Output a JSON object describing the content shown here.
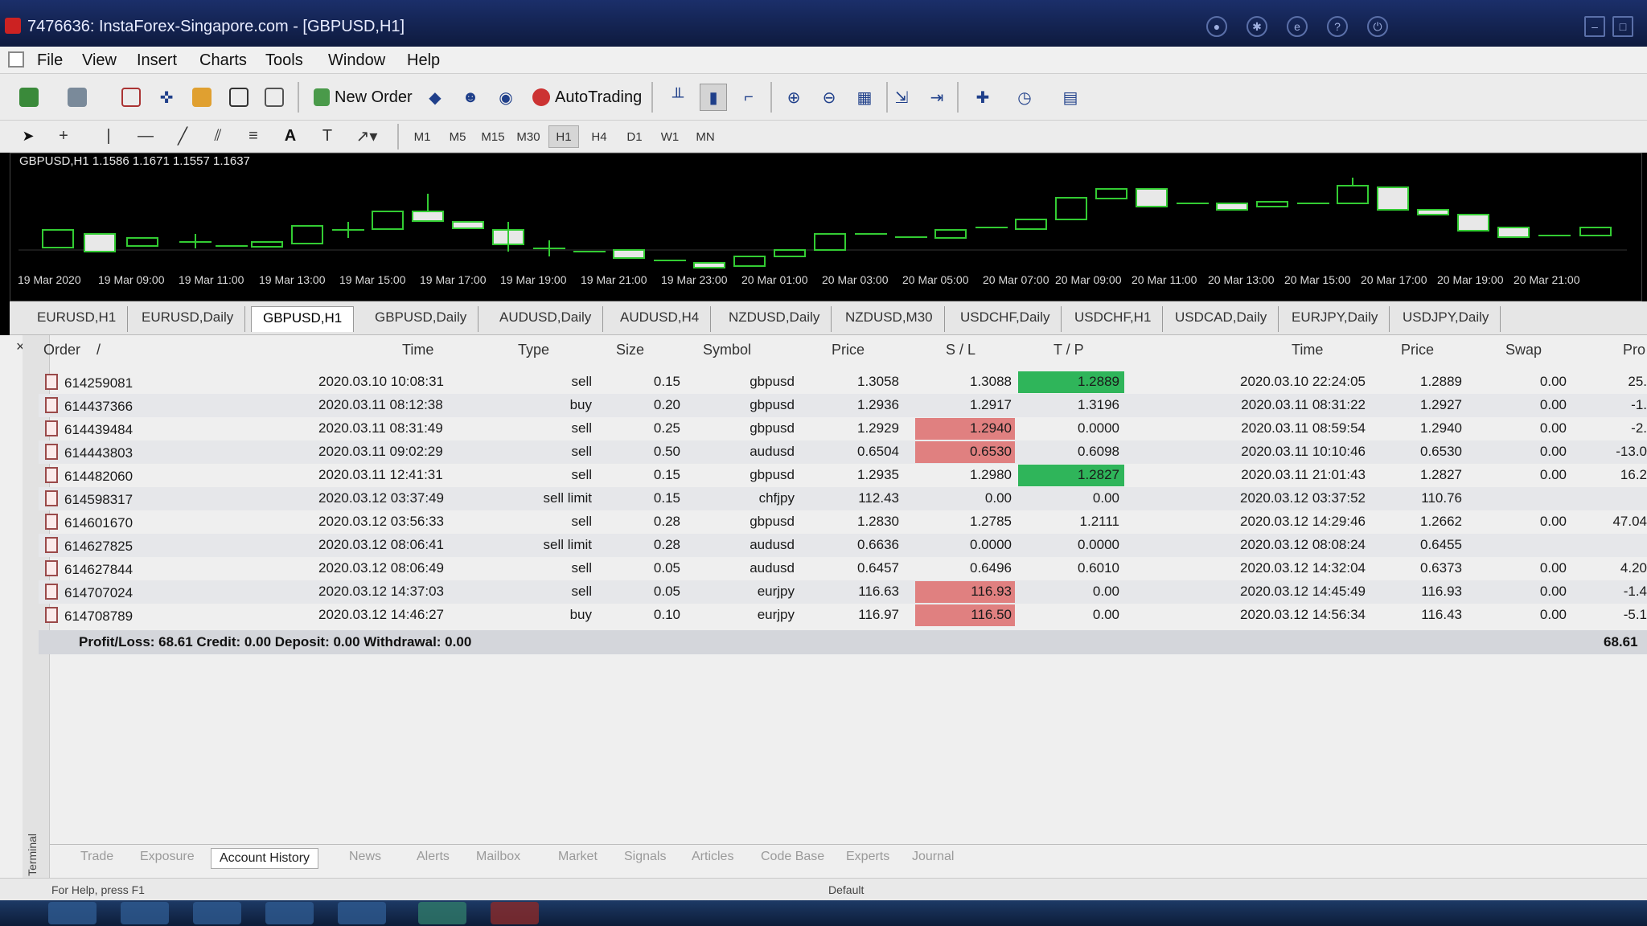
{
  "window": {
    "title": "7476636: InstaForex-Singapore.com - [GBPUSD,H1]"
  },
  "menu": [
    "File",
    "View",
    "Insert",
    "Charts",
    "Tools",
    "Window",
    "Help"
  ],
  "toolbar": {
    "new_order": "New Order",
    "auto_trading": "AutoTrading"
  },
  "timeframes": [
    "M1",
    "M5",
    "M15",
    "M30",
    "H1",
    "H4",
    "D1",
    "W1",
    "MN"
  ],
  "active_timeframe": "H1",
  "chart": {
    "label": "GBPUSD,H1  1.1586 1.1671 1.1557 1.1637",
    "time_labels": [
      "19 Mar 2020",
      "19 Mar 09:00",
      "19 Mar 11:00",
      "19 Mar 13:00",
      "19 Mar 15:00",
      "19 Mar 17:00",
      "19 Mar 19:00",
      "19 Mar 21:00",
      "19 Mar 23:00",
      "20 Mar 01:00",
      "20 Mar 03:00",
      "20 Mar 05:00",
      "20 Mar 07:00",
      "20 Mar 09:00",
      "20 Mar 11:00",
      "20 Mar 13:00",
      "20 Mar 15:00",
      "20 Mar 17:00",
      "20 Mar 19:00",
      "20 Mar 21:00"
    ]
  },
  "chart_tabs": [
    "EURUSD,H1",
    "EURUSD,Daily",
    "GBPUSD,H1",
    "GBPUSD,Daily",
    "AUDUSD,Daily",
    "AUDUSD,H4",
    "NZDUSD,Daily",
    "NZDUSD,M30",
    "USDCHF,Daily",
    "USDCHF,H1",
    "USDCAD,Daily",
    "EURJPY,Daily",
    "USDJPY,Daily"
  ],
  "active_chart_tab": "GBPUSD,H1",
  "table": {
    "headers": {
      "order": "Order",
      "sort": "/",
      "time": "Time",
      "type": "Type",
      "size": "Size",
      "symbol": "Symbol",
      "price": "Price",
      "sl": "S / L",
      "tp": "T / P",
      "time2": "Time",
      "price2": "Price",
      "swap": "Swap",
      "profit": "Pro"
    },
    "rows": [
      {
        "order": "614259081",
        "time": "2020.03.10 10:08:31",
        "type": "sell",
        "size": "0.15",
        "symbol": "gbpusd",
        "price": "1.3058",
        "sl": "1.3088",
        "tp": "1.2889",
        "time2": "2020.03.10 22:24:05",
        "price2": "1.2889",
        "swap": "0.00",
        "profit": "25.",
        "sl_hl": "",
        "tp_hl": "green"
      },
      {
        "order": "614437366",
        "time": "2020.03.11 08:12:38",
        "type": "buy",
        "size": "0.20",
        "symbol": "gbpusd",
        "price": "1.2936",
        "sl": "1.2917",
        "tp": "1.3196",
        "time2": "2020.03.11 08:31:22",
        "price2": "1.2927",
        "swap": "0.00",
        "profit": "-1.",
        "sl_hl": "",
        "tp_hl": ""
      },
      {
        "order": "614439484",
        "time": "2020.03.11 08:31:49",
        "type": "sell",
        "size": "0.25",
        "symbol": "gbpusd",
        "price": "1.2929",
        "sl": "1.2940",
        "tp": "0.0000",
        "time2": "2020.03.11 08:59:54",
        "price2": "1.2940",
        "swap": "0.00",
        "profit": "-2.",
        "sl_hl": "red",
        "tp_hl": ""
      },
      {
        "order": "614443803",
        "time": "2020.03.11 09:02:29",
        "type": "sell",
        "size": "0.50",
        "symbol": "audusd",
        "price": "0.6504",
        "sl": "0.6530",
        "tp": "0.6098",
        "time2": "2020.03.11 10:10:46",
        "price2": "0.6530",
        "swap": "0.00",
        "profit": "-13.0",
        "sl_hl": "red",
        "tp_hl": ""
      },
      {
        "order": "614482060",
        "time": "2020.03.11 12:41:31",
        "type": "sell",
        "size": "0.15",
        "symbol": "gbpusd",
        "price": "1.2935",
        "sl": "1.2980",
        "tp": "1.2827",
        "time2": "2020.03.11 21:01:43",
        "price2": "1.2827",
        "swap": "0.00",
        "profit": "16.2",
        "sl_hl": "",
        "tp_hl": "green"
      },
      {
        "order": "614598317",
        "time": "2020.03.12 03:37:49",
        "type": "sell limit",
        "size": "0.15",
        "symbol": "chfjpy",
        "price": "112.43",
        "sl": "0.00",
        "tp": "0.00",
        "time2": "2020.03.12 03:37:52",
        "price2": "110.76",
        "swap": "",
        "profit": "",
        "sl_hl": "",
        "tp_hl": ""
      },
      {
        "order": "614601670",
        "time": "2020.03.12 03:56:33",
        "type": "sell",
        "size": "0.28",
        "symbol": "gbpusd",
        "price": "1.2830",
        "sl": "1.2785",
        "tp": "1.2111",
        "time2": "2020.03.12 14:29:46",
        "price2": "1.2662",
        "swap": "0.00",
        "profit": "47.04",
        "sl_hl": "",
        "tp_hl": ""
      },
      {
        "order": "614627825",
        "time": "2020.03.12 08:06:41",
        "type": "sell limit",
        "size": "0.28",
        "symbol": "audusd",
        "price": "0.6636",
        "sl": "0.0000",
        "tp": "0.0000",
        "time2": "2020.03.12 08:08:24",
        "price2": "0.6455",
        "swap": "",
        "profit": "",
        "sl_hl": "",
        "tp_hl": ""
      },
      {
        "order": "614627844",
        "time": "2020.03.12 08:06:49",
        "type": "sell",
        "size": "0.05",
        "symbol": "audusd",
        "price": "0.6457",
        "sl": "0.6496",
        "tp": "0.6010",
        "time2": "2020.03.12 14:32:04",
        "price2": "0.6373",
        "swap": "0.00",
        "profit": "4.20",
        "sl_hl": "",
        "tp_hl": ""
      },
      {
        "order": "614707024",
        "time": "2020.03.12 14:37:03",
        "type": "sell",
        "size": "0.05",
        "symbol": "eurjpy",
        "price": "116.63",
        "sl": "116.93",
        "tp": "0.00",
        "time2": "2020.03.12 14:45:49",
        "price2": "116.93",
        "swap": "0.00",
        "profit": "-1.4",
        "sl_hl": "red",
        "tp_hl": ""
      },
      {
        "order": "614708789",
        "time": "2020.03.12 14:46:27",
        "type": "buy",
        "size": "0.10",
        "symbol": "eurjpy",
        "price": "116.97",
        "sl": "116.50",
        "tp": "0.00",
        "time2": "2020.03.12 14:56:34",
        "price2": "116.43",
        "swap": "0.00",
        "profit": "-5.1",
        "sl_hl": "red",
        "tp_hl": ""
      }
    ],
    "summary": "Profit/Loss: 68.61  Credit: 0.00  Deposit: 0.00  Withdrawal: 0.00",
    "summary_total": "68.61"
  },
  "bottom_tabs": [
    "Trade",
    "Exposure",
    "Account History",
    "News",
    "Alerts",
    "Mailbox",
    "Market",
    "Signals",
    "Articles",
    "Code Base",
    "Experts",
    "Journal"
  ],
  "active_bottom_tab": "Account History",
  "terminal_label": "Terminal",
  "status": {
    "help": "For Help, press F1",
    "profile": "Default"
  }
}
